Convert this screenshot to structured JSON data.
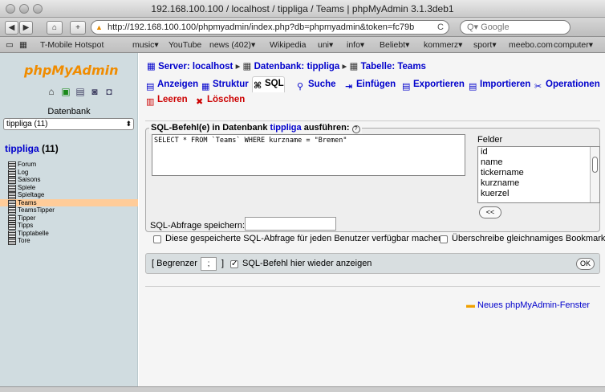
{
  "window": {
    "title": "192.168.100.100 / localhost / tippliga / Teams | phpMyAdmin 3.1.3deb1"
  },
  "toolbar": {
    "back": "◀",
    "forward": "▶",
    "home": "⌂",
    "add": "+",
    "url": "http://192.168.100.100/phpmyadmin/index.php?db=phpmyadmin&token=fc79b",
    "reload": "C",
    "search_placeholder": "Q▾ Google"
  },
  "bookmarks": [
    {
      "label": "T-Mobile Hotspot"
    },
    {
      "label": "music▾"
    },
    {
      "label": "YouTube"
    },
    {
      "label": "news (402)▾"
    },
    {
      "label": "Wikipedia"
    },
    {
      "label": "uni▾"
    },
    {
      "label": "info▾"
    },
    {
      "label": "Beliebt▾"
    },
    {
      "label": "kommerz▾"
    },
    {
      "label": "sport▾"
    },
    {
      "label": "meebo.com"
    },
    {
      "label": "computer▾"
    }
  ],
  "sidebar": {
    "logo_php": "php",
    "logo_name": "MyAdmin",
    "db_label": "Datenbank",
    "db_select": "tippliga (11)",
    "db_name": "tippliga",
    "db_count": "(11)",
    "tables": [
      "Forum",
      "Log",
      "Saisons",
      "Spiele",
      "Spieltage",
      "Teams",
      "TeamsTipper",
      "Tipper",
      "Tipps",
      "Tipptabelle",
      "Tore"
    ],
    "selected_table": "Teams"
  },
  "breadcrumb": {
    "server": "Server: localhost",
    "database": "Datenbank: tippliga",
    "table": "Tabelle: Teams"
  },
  "tabs": [
    {
      "label": "Anzeigen",
      "icon": "▤"
    },
    {
      "label": "Struktur",
      "icon": "▦"
    },
    {
      "label": "SQL",
      "icon": "⌘"
    },
    {
      "label": "Suche",
      "icon": "⚲"
    },
    {
      "label": "Einfügen",
      "icon": "⇥"
    },
    {
      "label": "Exportieren",
      "icon": "▤"
    },
    {
      "label": "Importieren",
      "icon": "▤"
    },
    {
      "label": "Operationen",
      "icon": "✂"
    },
    {
      "label": "Leeren",
      "icon": "▥"
    },
    {
      "label": "Löschen",
      "icon": "✖"
    }
  ],
  "sql": {
    "legend_prefix": "SQL-Befehl(e) in Datenbank",
    "legend_db": "tippliga",
    "legend_suffix": "ausführen:",
    "help": "?",
    "query": "SELECT * FROM `Teams` WHERE kurzname = \"Bremen\"",
    "fields_label": "Felder",
    "fields": [
      "id",
      "name",
      "tickername",
      "kurzname",
      "kuerzel"
    ],
    "insert_button": "<<",
    "save_label": "SQL-Abfrage speichern:",
    "save_value": "",
    "checkbox_all_users": "Diese gespeicherte SQL-Abfrage für jeden Benutzer verfügbar machen",
    "checkbox_overwrite": "Überschreibe gleichnamiges Bookmark"
  },
  "footer": {
    "limiter_open": "[ Begrenzer",
    "limiter_value": ";",
    "limiter_close": "]",
    "show_again": "SQL-Befehl hier wieder anzeigen",
    "check": "✓",
    "ok": "OK"
  },
  "new_window": "Neues phpMyAdmin-Fenster"
}
